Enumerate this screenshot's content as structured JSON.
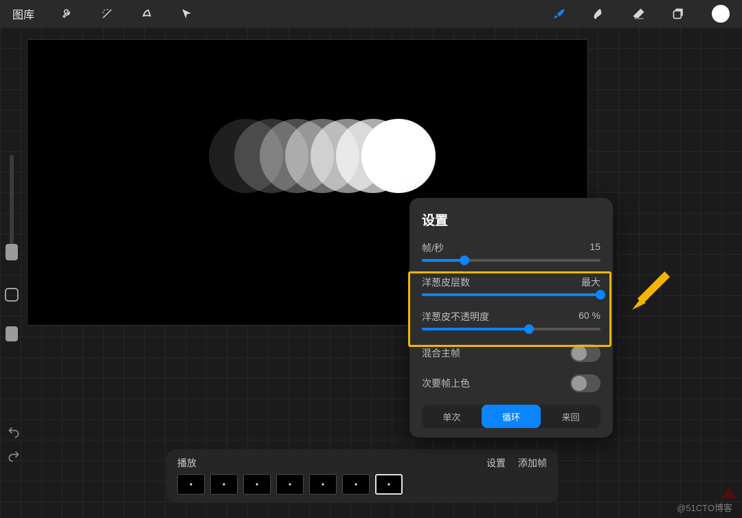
{
  "topbar": {
    "gallery": "图库"
  },
  "canvas": {
    "onion_skin_visible_frames": 7,
    "onion_skin_opacity_percent": 60
  },
  "popover": {
    "title": "设置",
    "fps_label": "帧/秒",
    "fps_value": "15",
    "fps_fill_pct": 24,
    "layers_label": "洋葱皮层数",
    "layers_value": "最大",
    "layers_fill_pct": 100,
    "opacity_label": "洋葱皮不透明度",
    "opacity_value": "60 %",
    "opacity_fill_pct": 60,
    "mix_main_label": "混合主帧",
    "tint_secondary_label": "次要帧上色",
    "seg_once": "单次",
    "seg_loop": "循环",
    "seg_pingpong": "来回"
  },
  "timeline": {
    "play": "播放",
    "settings": "设置",
    "add_frame": "添加帧",
    "frame_count": 7,
    "selected_index": 6
  },
  "watermark": "@51CTO博客"
}
